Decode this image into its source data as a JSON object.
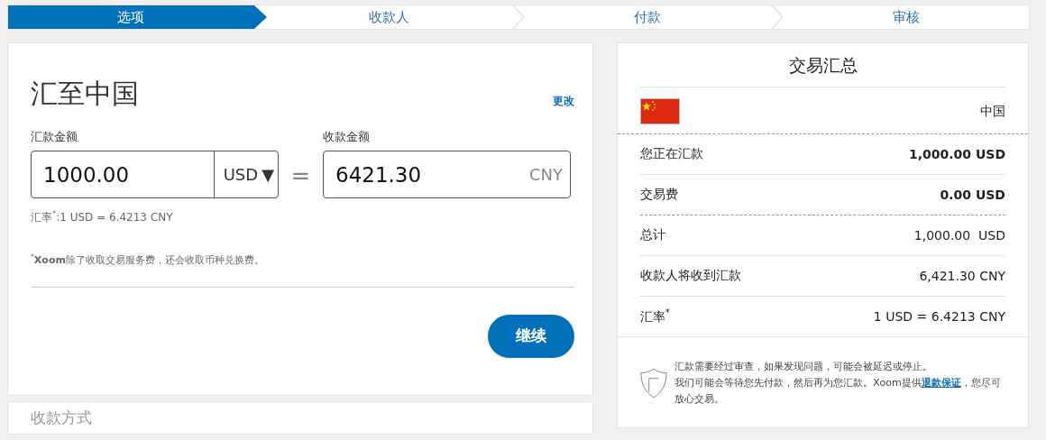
{
  "steps": [
    {
      "label": "选项",
      "selected": true
    },
    {
      "label": "收款人",
      "selected": false
    },
    {
      "label": "付款",
      "selected": false
    },
    {
      "label": "审核",
      "selected": false
    }
  ],
  "send_card": {
    "title": "汇至中国",
    "change_link": "更改",
    "send_label": "汇款金额",
    "send_value": "1000.00",
    "send_currency": "USD",
    "caret": "▼",
    "equals": "=",
    "receive_label": "收款金额",
    "receive_value": "6421.30",
    "receive_currency": "CNY",
    "rate": "汇率$^{*}$:1 USD = 6.4213 CNY",
    "footnote": "$^{*}$**Xoom**除了收取交易服务费，还会收取币种兑换费。",
    "continue_button": "继续"
  },
  "delivery_card": {
    "title": "收款方式"
  },
  "summary": {
    "title": "交易汇总",
    "country": "中国",
    "rows": [
      {
        "label": "您正在汇款",
        "value": "1,000.00 USD",
        "bold": true,
        "divider": true,
        "dashed": false
      },
      {
        "label": "交易费",
        "value": "0.00 USD",
        "bold": true,
        "divider": true,
        "dashed": true
      },
      {
        "label": "总计",
        "value": "1,000.00  USD",
        "bold": false,
        "divider": true,
        "dashed": false
      },
      {
        "label": "收款人将收到汇款",
        "value": "6,421.30 CNY",
        "bold": false,
        "divider": true,
        "dashed": false
      },
      {
        "label": "汇率$^{*}$",
        "value": "1 USD = 6.4213 CNY",
        "bold": false,
        "divider": false
      }
    ],
    "notice": {
      "line_1": "汇款需要经过审查，如果发现问题，可能会被延迟或停止。",
      "line_2": "我们可能会等待您先付款，然后再为您汇款。Xoom提供",
      "link": "退款保证",
      "line_3": "，您尽可放心交易。"
    }
  }
}
